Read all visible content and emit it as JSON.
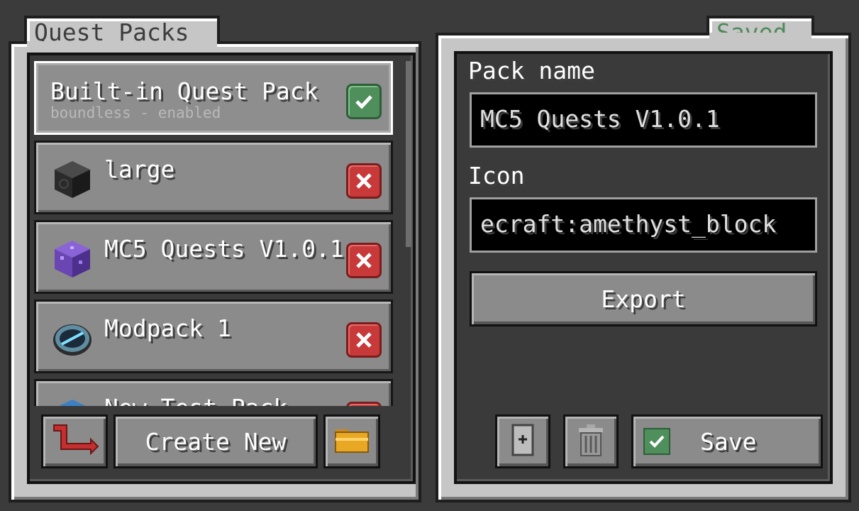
{
  "left": {
    "tab_label": "Quest Packs",
    "packs": [
      {
        "name": "Built-in Quest Pack",
        "subtitle": "boundless - enabled",
        "status": "enabled"
      },
      {
        "name": "large",
        "status": "removable"
      },
      {
        "name": "MC5 Quests V1.0.1",
        "status": "removable"
      },
      {
        "name": "Modpack 1",
        "status": "removable"
      },
      {
        "name": "New Test Pack",
        "status": "removable"
      }
    ],
    "back_icon": "red-return-arrow-icon",
    "create_new_label": "Create New",
    "folder_icon": "folder-icon"
  },
  "right": {
    "tab_label": "Saved",
    "pack_name_label": "Pack name",
    "pack_name_value": "MC5 Quests V1.0.1",
    "icon_label": "Icon",
    "icon_value": "ecraft:amethyst_block",
    "export_label": "Export",
    "save_label": "Save"
  },
  "colors": {
    "saved_text": "#4f8a5b",
    "check_badge": "#4e8f5c",
    "cross_badge": "#c83a3a"
  }
}
